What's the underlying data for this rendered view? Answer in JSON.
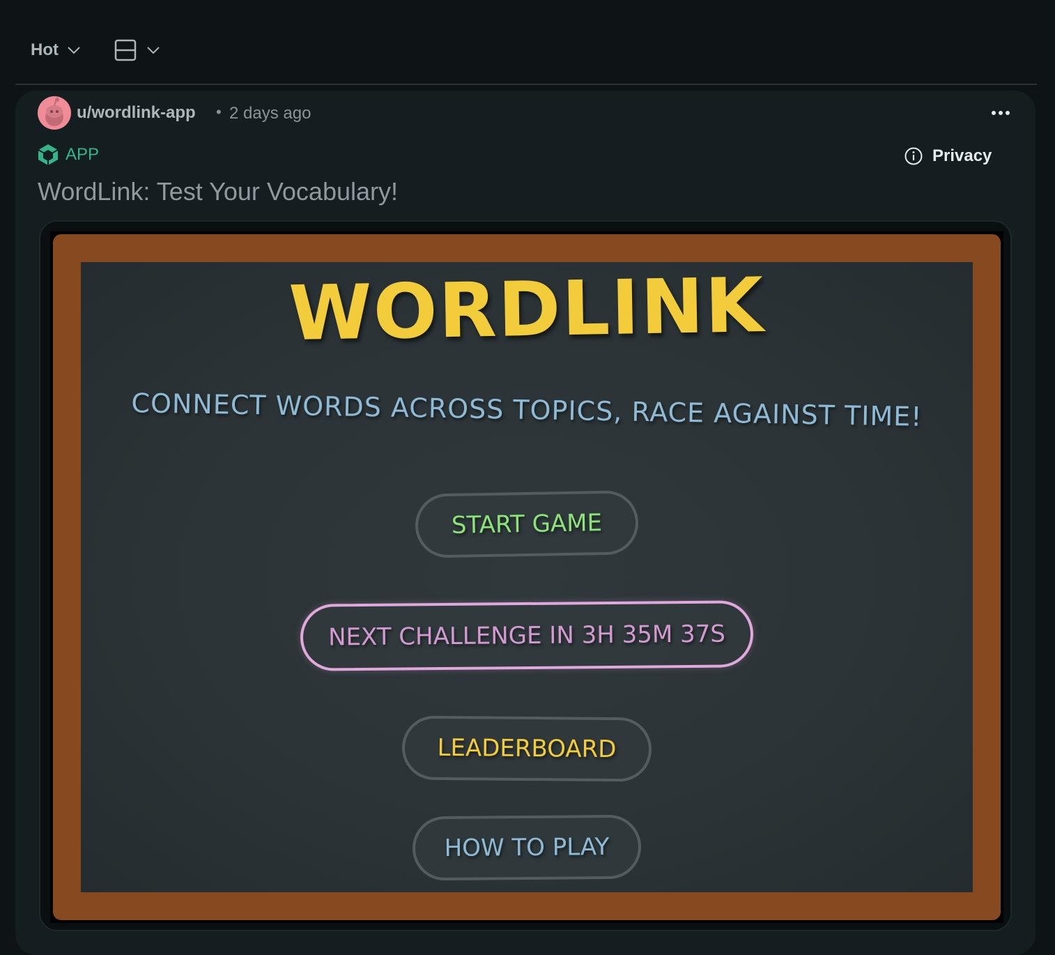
{
  "toolbar": {
    "sort_label": "Hot"
  },
  "post": {
    "author": "u/wordlink-app",
    "separator": "•",
    "time": "2 days ago",
    "badge": "APP",
    "privacy_label": "Privacy",
    "title": "WordLink: Test Your Vocabulary!"
  },
  "game": {
    "title": "WORDLINK",
    "tagline": "CONNECT WORDS ACROSS TOPICS, RACE AGAINST TIME!",
    "buttons": {
      "start": "START GAME",
      "next": "NEXT CHALLENGE IN 3H 35M 37S",
      "leaderboard": "LEADERBOARD",
      "how_to_play": "HOW TO PLAY"
    }
  },
  "colors": {
    "background": "#0e1416",
    "card": "#141d20",
    "app_green": "#35b389",
    "wood": "#874920",
    "chalkboard": "#2b3336",
    "title_yellow": "#f2cc3a",
    "chalk_blue": "#8fbad6",
    "chalk_green": "#8ee27a",
    "chalk_pink": "#d39ad2"
  }
}
